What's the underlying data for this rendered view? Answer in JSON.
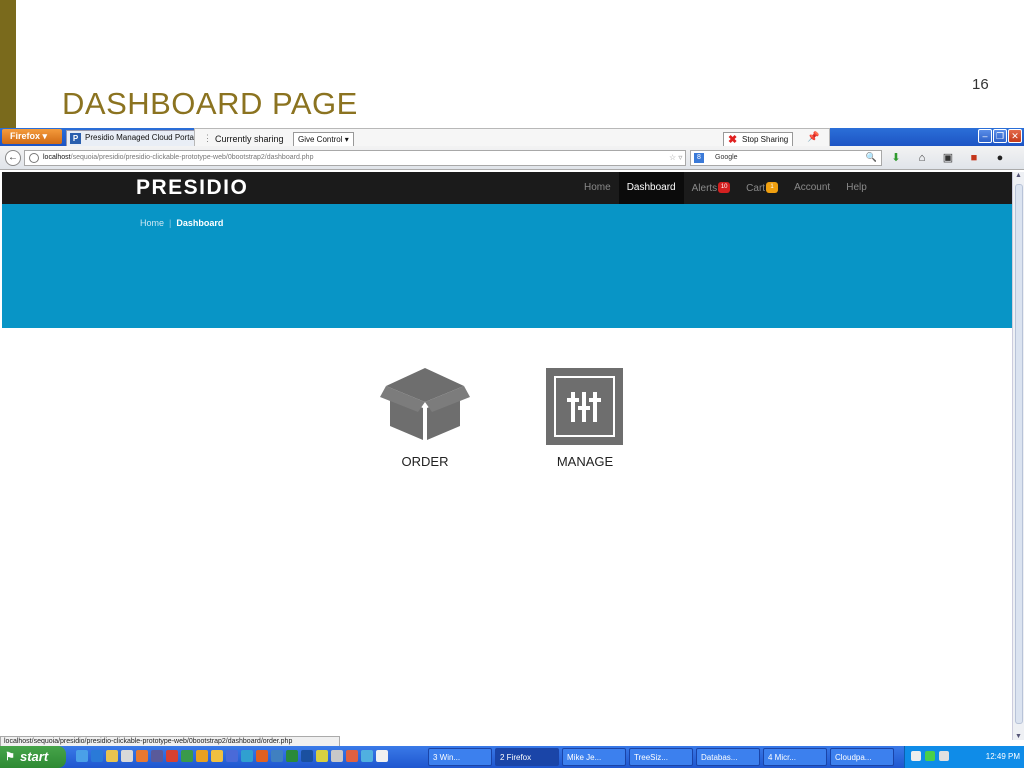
{
  "slide": {
    "title": "DASHBOARD PAGE",
    "page_number": "16"
  },
  "browser": {
    "app_button": "Firefox",
    "tab_title": "Presidio Managed Cloud Portal - (",
    "tab_icon_letter": "P",
    "share_status": "Currently sharing",
    "give_control": "Give Control",
    "stop_sharing": "Stop Sharing",
    "url_host": "localhost",
    "url_path": "/sequoia/presidio/presidio-clickable-prototype-web/0bootstrap2/dashboard.php",
    "search_engine": "Google",
    "status_url": "localhost/sequoia/presidio/presidio-clickable-prototype-web/0bootstrap2/dashboard/order.php"
  },
  "site": {
    "brand": "PRESIDIO",
    "nav": [
      {
        "label": "Home",
        "active": false
      },
      {
        "label": "Dashboard",
        "active": true
      },
      {
        "label": "Alerts",
        "badge": "10",
        "badge_color": "red"
      },
      {
        "label": "Cart",
        "badge": "1",
        "badge_color": "orange"
      },
      {
        "label": "Account"
      },
      {
        "label": "Help"
      }
    ],
    "breadcrumb": {
      "home": "Home",
      "separator": "|",
      "current": "Dashboard"
    },
    "tiles": [
      {
        "label": "ORDER",
        "icon": "box-icon"
      },
      {
        "label": "MANAGE",
        "icon": "sliders-icon"
      }
    ],
    "colors": {
      "nav_bg": "#1b1b1b",
      "hero_bg": "#0895c6",
      "icon_gray": "#6e6e6e",
      "slide_accent": "#8b7320"
    }
  },
  "taskbar": {
    "start": "start",
    "items": [
      "3 Win...",
      "2 Firefox",
      "Mike Je...",
      "TreeSiz...",
      "Databas...",
      "4 Micr...",
      "Cloudpa..."
    ],
    "clock": "12:49 PM"
  }
}
